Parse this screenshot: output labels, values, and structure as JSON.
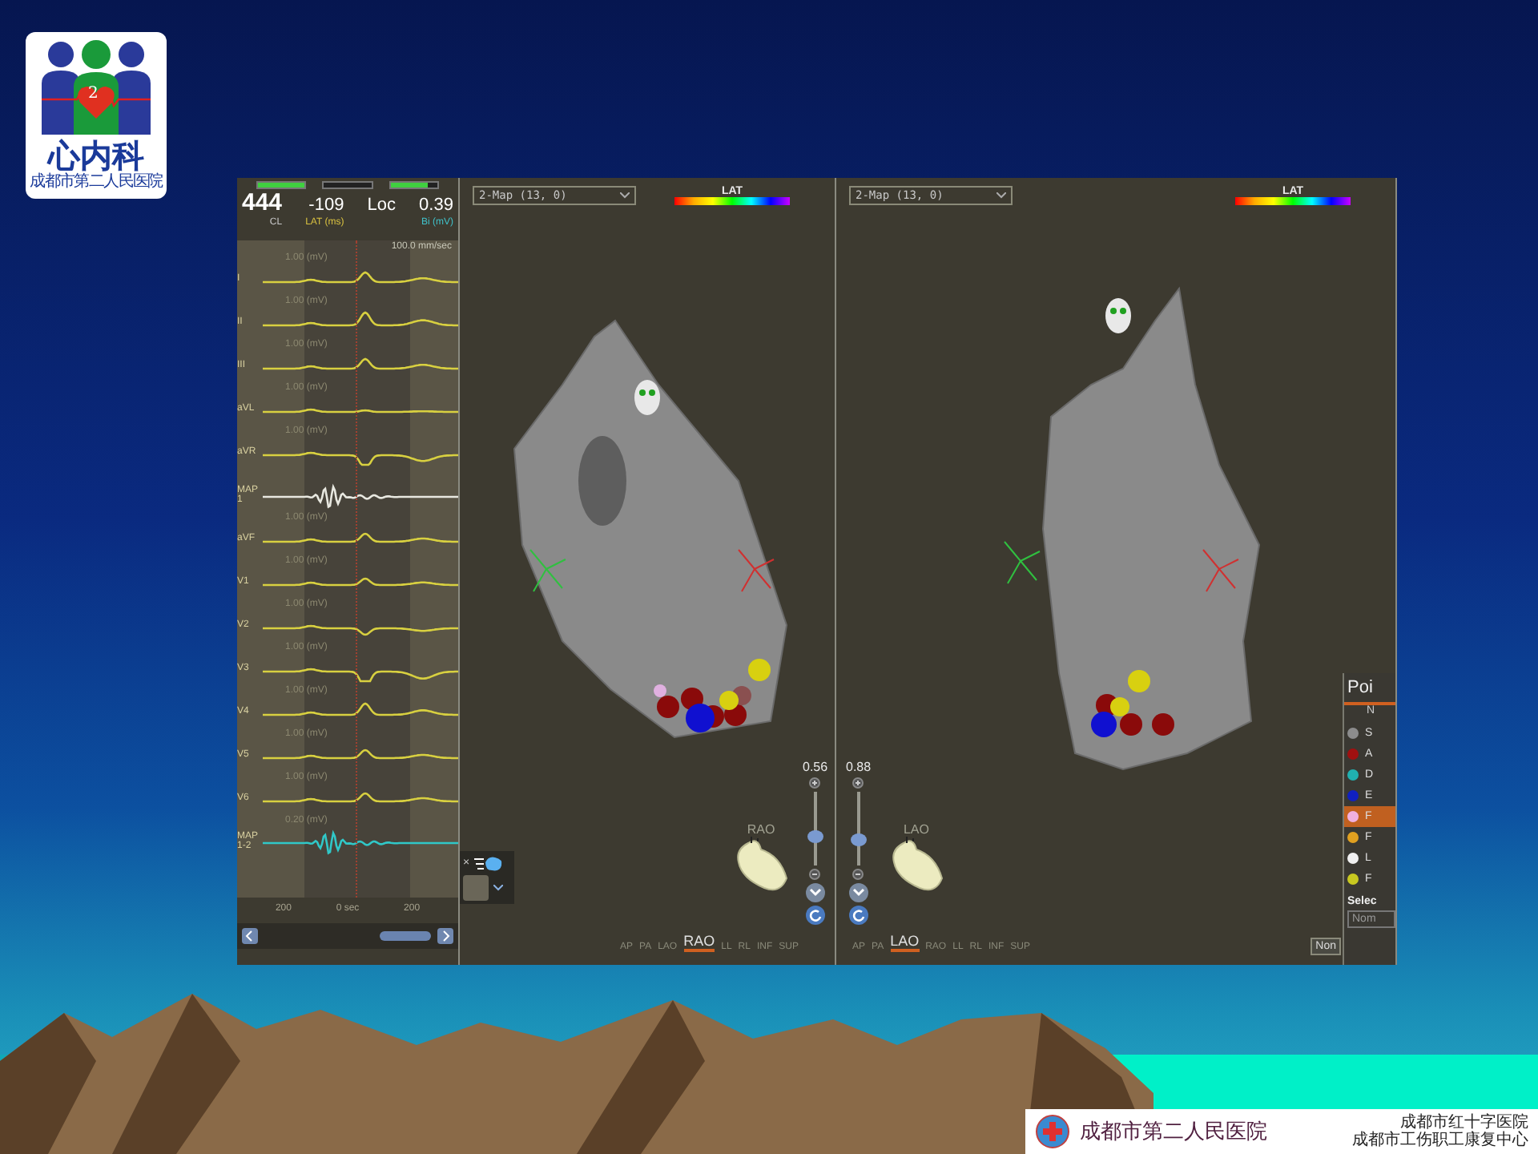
{
  "logo": {
    "badge": "2",
    "title": "心内科",
    "subtitle": "成都市第二人民医院"
  },
  "ecg_panel": {
    "indicators": [
      {
        "level": 1
      },
      {
        "level": 0
      },
      {
        "level": 0.8
      }
    ],
    "readings": [
      {
        "kind": "primary",
        "value": "444",
        "label": "CL",
        "color": "#c8c8c8"
      },
      {
        "kind": "secondary",
        "value": "-109",
        "label": "LAT (ms)",
        "color": "#d8c040"
      },
      {
        "kind": "secondary",
        "value": "Loc"
      },
      {
        "kind": "secondary",
        "value": "0.39",
        "label": "Bi (mV)",
        "color": "#40c0c8"
      }
    ],
    "sweep_speed": "100.0 mm/sec",
    "leads": [
      {
        "name": "I",
        "scale": "1.00 (mV)",
        "kind": "surface",
        "color": "#d8d040"
      },
      {
        "name": "II",
        "scale": "1.00 (mV)",
        "kind": "surface",
        "color": "#d8d040"
      },
      {
        "name": "III",
        "scale": "1.00 (mV)",
        "kind": "surface",
        "color": "#d8d040"
      },
      {
        "name": "aVL",
        "scale": "1.00 (mV)",
        "kind": "surface",
        "color": "#d8d040"
      },
      {
        "name": "aVR",
        "scale": "1.00 (mV)",
        "kind": "surface",
        "color": "#d8d040"
      },
      {
        "name": "MAP 1",
        "kind": "map",
        "color": "#e8e8e0"
      },
      {
        "name": "aVF",
        "scale": "1.00 (mV)",
        "kind": "surface",
        "color": "#d8d040"
      },
      {
        "name": "V1",
        "scale": "1.00 (mV)",
        "kind": "surface",
        "color": "#d8d040"
      },
      {
        "name": "V2",
        "scale": "1.00 (mV)",
        "kind": "surface",
        "color": "#d8d040"
      },
      {
        "name": "V3",
        "scale": "1.00 (mV)",
        "kind": "surface",
        "color": "#d8d040"
      },
      {
        "name": "V4",
        "scale": "1.00 (mV)",
        "kind": "surface",
        "color": "#d8d040"
      },
      {
        "name": "V5",
        "scale": "1.00 (mV)",
        "kind": "surface",
        "color": "#d8d040"
      },
      {
        "name": "V6",
        "scale": "1.00 (mV)",
        "kind": "surface",
        "color": "#d8d040"
      },
      {
        "name": "MAP 1-2",
        "scale": "0.20 (mV)",
        "kind": "map",
        "color": "#30c8c8"
      }
    ],
    "time_axis": [
      "200",
      "0 sec",
      "200"
    ]
  },
  "views": [
    {
      "kind": "rao",
      "map_select": "2-Map (13, 0)",
      "legend": "LAT",
      "zoom": "0.56",
      "slider": {
        "level": 0.4
      },
      "orientation_label": "RAO",
      "tool_palette": {
        "close": "×"
      },
      "view_buttons": [
        {
          "label": "AP",
          "selected": false
        },
        {
          "label": "PA",
          "selected": false
        },
        {
          "label": "LAO",
          "selected": false
        },
        {
          "label": "RAO",
          "selected": true
        },
        {
          "label": "LL",
          "selected": false
        },
        {
          "label": "RL",
          "selected": false
        },
        {
          "label": "INF",
          "selected": false
        },
        {
          "label": "SUP",
          "selected": false
        }
      ]
    },
    {
      "kind": "lao",
      "map_select": "2-Map (13, 0)",
      "legend": "LAT",
      "zoom": "0.88",
      "slider": {
        "level": 0.35
      },
      "orientation_label": "LAO",
      "none_button": "Non",
      "view_buttons": [
        {
          "label": "AP",
          "selected": false
        },
        {
          "label": "PA",
          "selected": false
        },
        {
          "label": "LAO",
          "selected": true
        },
        {
          "label": "RAO",
          "selected": false
        },
        {
          "label": "LL",
          "selected": false
        },
        {
          "label": "RL",
          "selected": false
        },
        {
          "label": "INF",
          "selected": false
        },
        {
          "label": "SUP",
          "selected": false
        }
      ],
      "points_panel": {
        "title": "Poi",
        "header": "N",
        "items": [
          {
            "label": "S",
            "color": "#8c8c8c",
            "selected": false
          },
          {
            "label": "A",
            "color": "#a01010",
            "selected": false
          },
          {
            "label": "D",
            "color": "#20b0b0",
            "selected": false
          },
          {
            "label": "E",
            "color": "#1020c0",
            "selected": false
          },
          {
            "label": "F",
            "color": "#f0b0e0",
            "selected": true
          },
          {
            "label": "F",
            "color": "#e0a020",
            "selected": false
          },
          {
            "label": "L",
            "color": "#f0f0f0",
            "selected": false
          },
          {
            "label": "F",
            "color": "#c8c820",
            "selected": false
          }
        ],
        "select_label": "Selec",
        "select_value": "Nom"
      }
    }
  ],
  "footer": {
    "hospital": "成都市第二人民医院",
    "affiliations": [
      "成都市红十字医院",
      "成都市工伤职工康复中心"
    ]
  }
}
